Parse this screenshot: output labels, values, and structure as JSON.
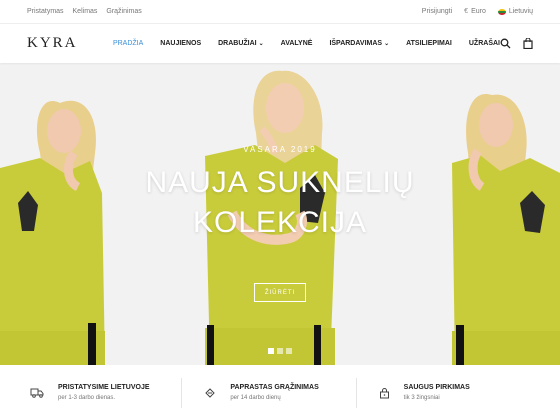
{
  "topbar": {
    "links": [
      "Pristatymas",
      "Kelimas",
      "Grąžinimas"
    ],
    "login": "Prisijungti",
    "currency": "Euro",
    "currency_symbol": "€",
    "language": "Lietuvių"
  },
  "header": {
    "logo": "KYRA",
    "nav": [
      {
        "label": "PRADŽIA",
        "active": true,
        "dropdown": false
      },
      {
        "label": "NAUJIENOS",
        "active": false,
        "dropdown": false
      },
      {
        "label": "DRABUŽIAI",
        "active": false,
        "dropdown": true
      },
      {
        "label": "AVALYNĖ",
        "active": false,
        "dropdown": false
      },
      {
        "label": "IŠPARDAVIMAS",
        "active": false,
        "dropdown": true
      },
      {
        "label": "ATSILIEPIMAI",
        "active": false,
        "dropdown": false
      },
      {
        "label": "UŽRAŠAI",
        "active": false,
        "dropdown": false
      }
    ],
    "icons": [
      "search-icon",
      "shopping-bag-icon"
    ],
    "active_color": "#3a8fd8"
  },
  "hero": {
    "subtitle": "VASARA 2019",
    "title_line1": "NAUJA SUKNELIŲ",
    "title_line2": "KOLEKCIJA",
    "cta": "ŽIŪRĖTI",
    "slides": 3,
    "active_slide": 1,
    "dress_color": "#c9cc3a"
  },
  "features": [
    {
      "icon": "truck-icon",
      "title": "PRISTATYSIME LIETUVOJE",
      "desc": "per 1-3 darbo dienas."
    },
    {
      "icon": "return-icon",
      "title": "PAPRASTAS GRĄŽINIMAS",
      "desc": "per 14 darbo dienų"
    },
    {
      "icon": "lock-icon",
      "title": "SAUGUS PIRKIMAS",
      "desc": "tik 3 žingsniai"
    }
  ]
}
